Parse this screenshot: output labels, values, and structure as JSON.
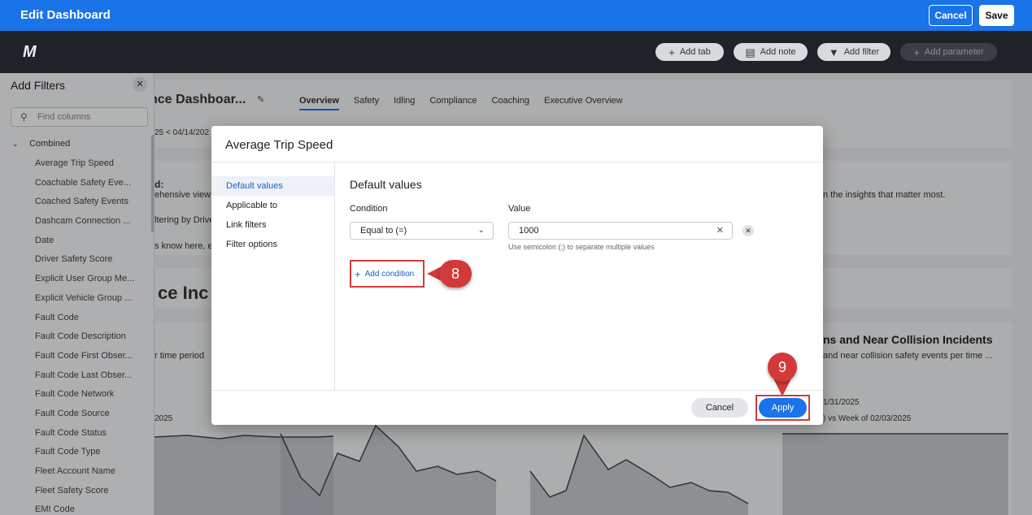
{
  "topbar": {
    "title": "Edit Dashboard",
    "cancel_label": "Cancel",
    "save_label": "Save"
  },
  "toolbar": {
    "logo": "M",
    "add_tab": "Add tab",
    "add_note": "Add note",
    "add_filter": "Add filter",
    "add_parameter": "Add parameter"
  },
  "dashboard": {
    "title": "nce Dashboar...",
    "tabs": [
      "Overview",
      "Safety",
      "Idling",
      "Compliance",
      "Coaching",
      "Executive Overview"
    ],
    "date_range": "25 < 04/14/202",
    "intro_colon": "d:",
    "intro_line1": "ehensive view",
    "intro_line2": "ltering by Drive",
    "intro_line3": "s know here, e",
    "right_text": "n the insights that matter most.",
    "section_heading": "ce Inc",
    "left_time": "r time period",
    "left_year": "2025",
    "right_heading": "ns and Near Collision Incidents",
    "right_sub": "and near collision safety events per time ...",
    "right_date": "1/31/2025",
    "right_week": ") vs Week of 02/03/2025"
  },
  "panel": {
    "title": "Add Filters",
    "search_placeholder": "Find columns",
    "group": "Combined",
    "items": [
      "Average Trip Speed",
      "Coachable Safety Eve...",
      "Coached Safety Events",
      "Dashcam Connection ...",
      "Date",
      "Driver Safety Score",
      "Explicit User Group Me...",
      "Explicit Vehicle Group ...",
      "Fault Code",
      "Fault Code Description",
      "Fault Code First Obser...",
      "Fault Code Last Obser...",
      "Fault Code Network",
      "Fault Code Source",
      "Fault Code Status",
      "Fault Code Type",
      "Fleet Account Name",
      "Fleet Safety Score",
      "EMI Code"
    ]
  },
  "modal": {
    "title": "Average Trip Speed",
    "nav": [
      "Default values",
      "Applicable to",
      "Link filters",
      "Filter options"
    ],
    "section_title": "Default values",
    "condition_label": "Condition",
    "value_label": "Value",
    "condition_value": "Equal to (=)",
    "value_value": "1000",
    "hint": "Use semicolon (;) to separate multiple values",
    "add_condition": "Add condition",
    "cancel_label": "Cancel",
    "apply_label": "Apply"
  },
  "callouts": {
    "step8": "8",
    "step9": "9"
  },
  "colors": {
    "primary": "#1a73e8",
    "toolbar": "#1f2329",
    "callout": "#d23a3a"
  }
}
